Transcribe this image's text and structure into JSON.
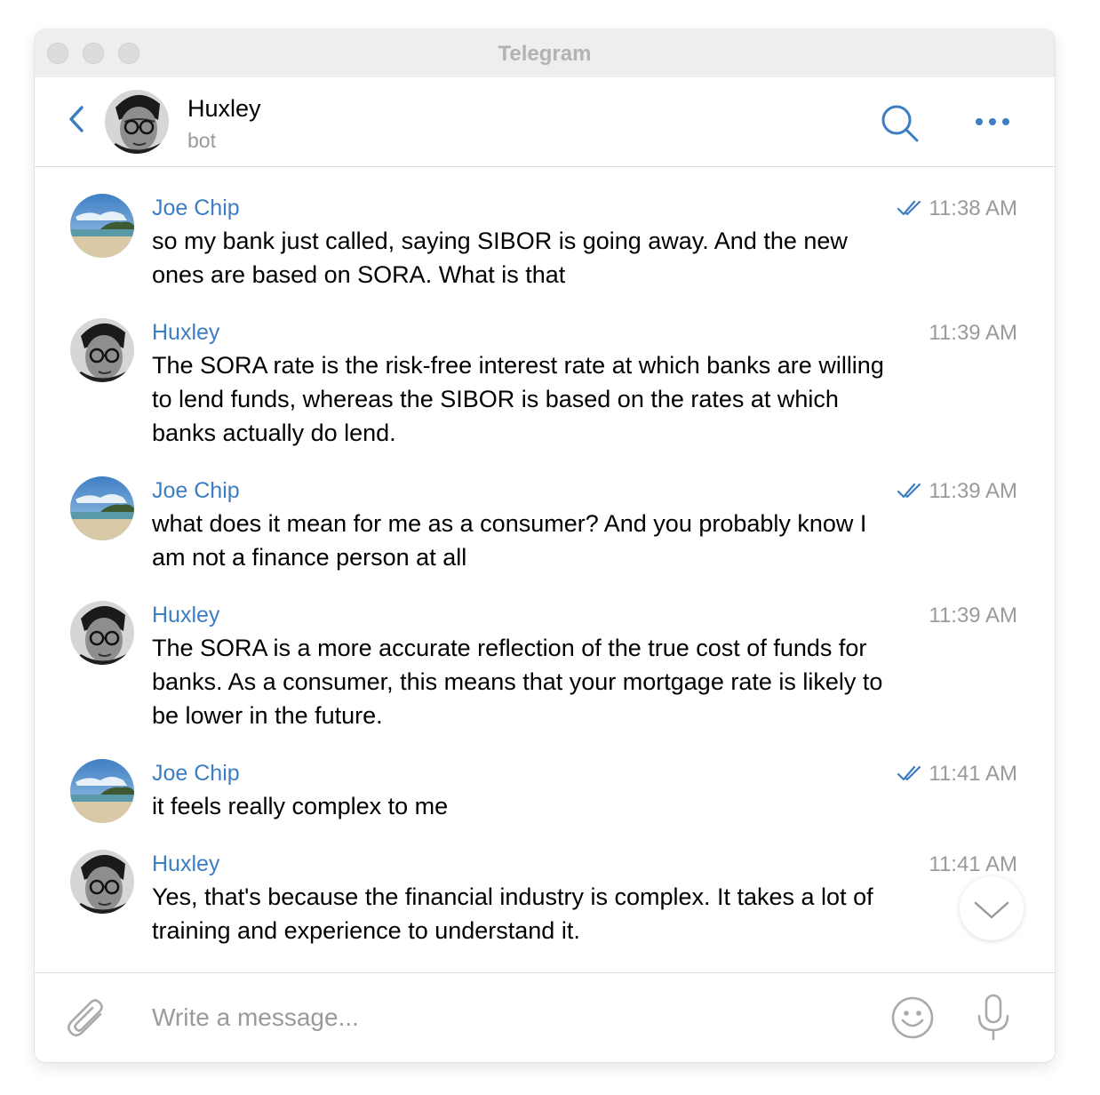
{
  "window": {
    "title": "Telegram"
  },
  "chat": {
    "name": "Huxley",
    "status": "bot"
  },
  "messages": [
    {
      "sender": "Joe Chip",
      "time": "11:38 AM",
      "read": true,
      "text": "so my bank just called, saying SIBOR is going away. And the new ones are based on SORA. What is that"
    },
    {
      "sender": "Huxley",
      "time": "11:39 AM",
      "read": false,
      "text": "The SORA rate is the risk-free interest rate at which banks are willing to lend funds, whereas the SIBOR is based on the rates at which banks actually do lend."
    },
    {
      "sender": "Joe Chip",
      "time": "11:39 AM",
      "read": true,
      "text": "what does it mean for me as a consumer? And you probably know I am not a finance person at all"
    },
    {
      "sender": "Huxley",
      "time": "11:39 AM",
      "read": false,
      "text": "The SORA is a more accurate reflection of the true cost of funds for banks. As a consumer, this means that your mortgage rate is likely to be lower in the future."
    },
    {
      "sender": "Joe Chip",
      "time": "11:41 AM",
      "read": true,
      "text": "it feels really complex to me"
    },
    {
      "sender": "Huxley",
      "time": "11:41 AM",
      "read": false,
      "text": "Yes, that's because the financial industry is complex. It takes a lot of training and experience to understand it."
    }
  ],
  "composer": {
    "placeholder": "Write a message..."
  },
  "icons": {
    "back": "chevron-left-icon",
    "search": "search-icon",
    "more": "more-icon",
    "attach": "paperclip-icon",
    "emoji": "emoji-icon",
    "mic": "microphone-icon",
    "scroll": "chevron-down-icon",
    "read": "double-check-icon"
  },
  "colors": {
    "accent": "#3d7ec3",
    "muted": "#9a9a9a",
    "icon": "#aaaaaa"
  }
}
